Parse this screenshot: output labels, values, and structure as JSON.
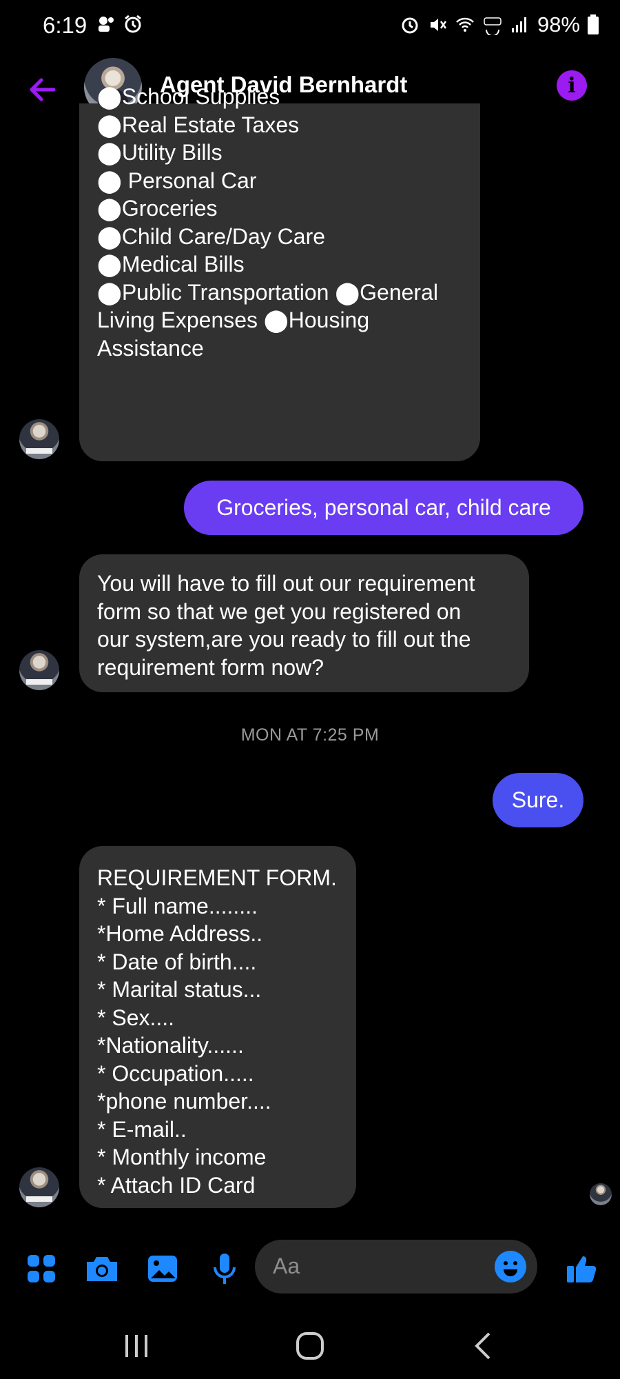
{
  "status_bar": {
    "time": "6:19",
    "battery": "98%"
  },
  "header": {
    "contact_name": "Agent David Bernhardt"
  },
  "messages": {
    "list_bubble_lines": [
      "⬤School Supplies",
      "⬤Real Estate Taxes",
      "⬤Utility Bills",
      "⬤ Personal Car",
      "⬤Groceries",
      "⬤Child Care/Day Care",
      "⬤Medical Bills",
      "⬤Public Transportation ⬤General",
      "Living Expenses ⬤Housing",
      "Assistance"
    ],
    "outgoing_1": "Groceries,  personal car, child care",
    "incoming_2_lines": [
      "You will have to fill out our requirement",
      "form so that we get you registered on",
      "our system,are you ready to fill out the",
      "requirement form now?"
    ],
    "timestamp": "MON AT 7:25 PM",
    "outgoing_2": "Sure.",
    "form_lines": [
      "REQUIREMENT FORM.",
      "* Full name........",
      "*Home Address..",
      "* Date of birth....",
      "* Marital status...",
      "* Sex....",
      "*Nationality......",
      "* Occupation.....",
      "*phone number....",
      "* E-mail..",
      "* Monthly income",
      "* Attach ID Card"
    ]
  },
  "composer": {
    "placeholder": "Aa"
  },
  "colors": {
    "accent_purple": "#9b1bf0",
    "outgoing_purple": "#6a3df2",
    "outgoing_blue": "#4a4ff0",
    "icon_blue": "#1e88ff",
    "bubble_gray": "#313131"
  }
}
